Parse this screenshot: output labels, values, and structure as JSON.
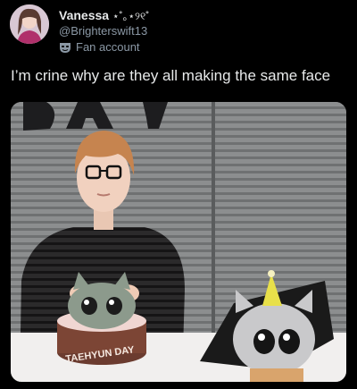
{
  "author": {
    "display_name": "Vanessa",
    "name_decoration": "⋆˚｡⋆୨୧˚",
    "handle": "@Brighterswift13",
    "account_label": "Fan account",
    "label_icon": "mask-icon"
  },
  "tweet": {
    "text": "I’m crine why are they all making the same face"
  },
  "media": {
    "banner_letters": "DAY",
    "cake_text": "TAEHYUN DAY"
  },
  "colors": {
    "background": "#000000",
    "primary_text": "#e7e9ea",
    "secondary_text": "#8b98a5"
  }
}
